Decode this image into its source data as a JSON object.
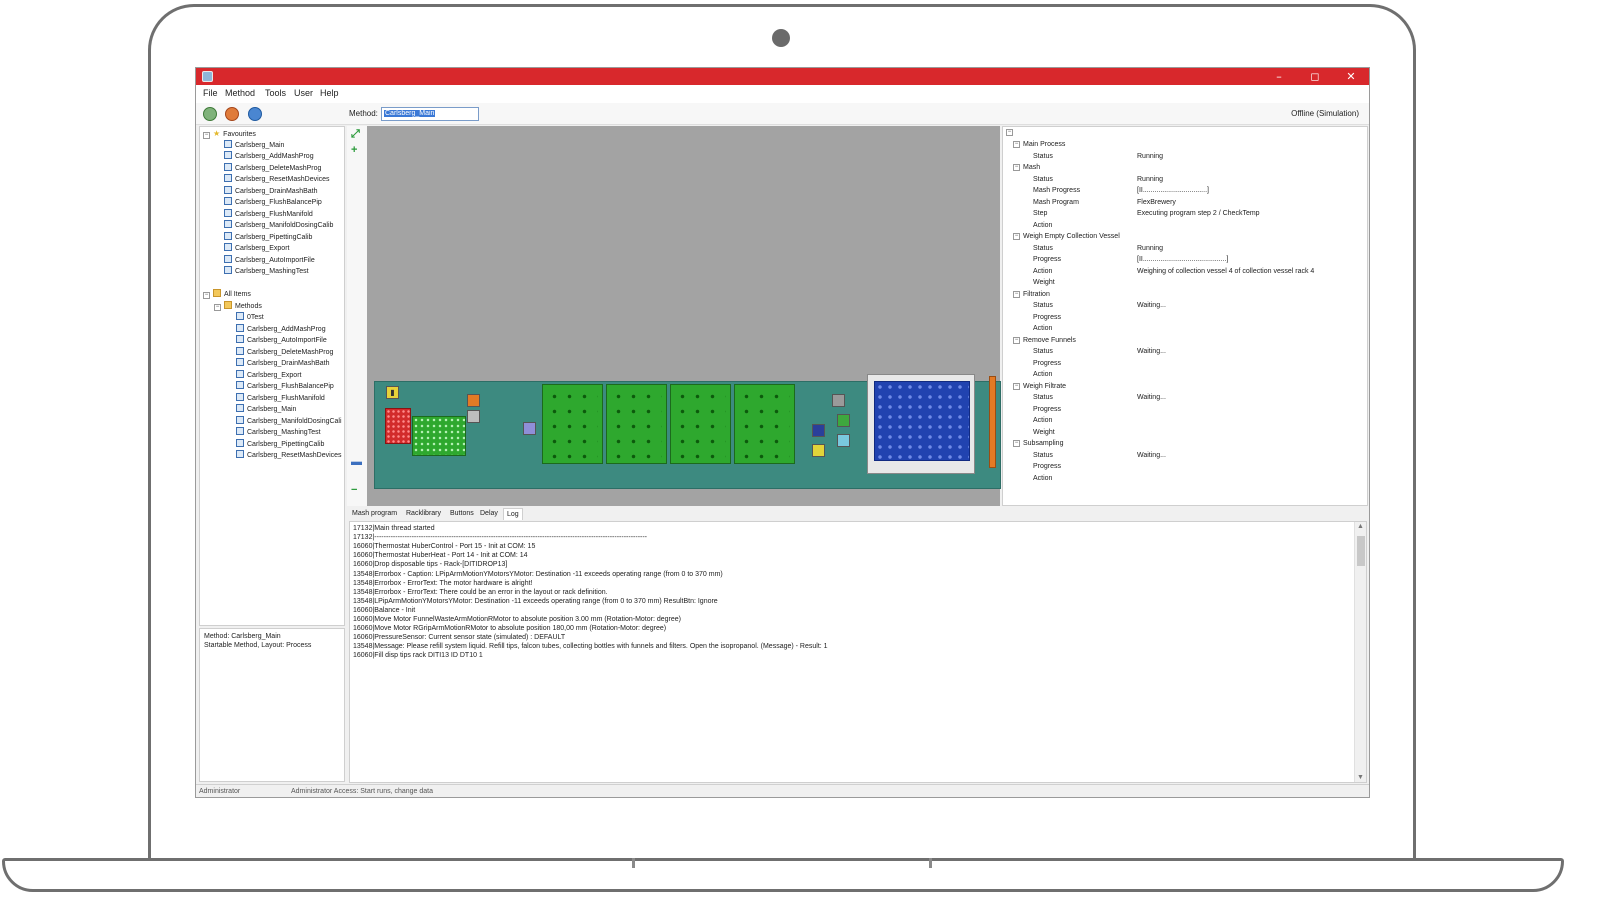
{
  "window": {
    "controls": {
      "minimize": "–",
      "maximize": "◻",
      "close": "✕"
    }
  },
  "menu": [
    "File",
    "Method",
    "Tools",
    "User",
    "Help"
  ],
  "toolbar": {
    "method_label": "Method:",
    "method_value": "Carlsberg_Main",
    "connection_status": "Offline (Simulation)"
  },
  "favourites": {
    "label": "Favourites",
    "items": [
      "Carlsberg_Main",
      "Carlsberg_AddMashProg",
      "Carlsberg_DeleteMashProg",
      "Carlsberg_ResetMashDevices",
      "Carlsberg_DrainMashBath",
      "Carlsberg_FlushBalancePip",
      "Carlsberg_FlushManifold",
      "Carlsberg_ManifoldDosingCalib",
      "Carlsberg_PipettingCalib",
      "Carlsberg_Export",
      "Carlsberg_AutoImportFile",
      "Carlsberg_MashingTest"
    ]
  },
  "all_items": {
    "label": "All Items",
    "methods_label": "Methods",
    "items": [
      "0Test",
      "Carlsberg_AddMashProg",
      "Carlsberg_AutoImportFile",
      "Carlsberg_DeleteMashProg",
      "Carlsberg_DrainMashBath",
      "Carlsberg_Export",
      "Carlsberg_FlushBalancePip",
      "Carlsberg_FlushManifold",
      "Carlsberg_Main",
      "Carlsberg_ManifoldDosingCali",
      "Carlsberg_MashingTest",
      "Carlsberg_PipettingCalib",
      "Carlsberg_ResetMashDevices"
    ]
  },
  "info": {
    "line1": "Method: Carlsberg_Main",
    "line2": "Startable Method, Layout: Process"
  },
  "status_tree": [
    {
      "level": 0,
      "key": "Main Process",
      "value": ""
    },
    {
      "level": 1,
      "key": "Status",
      "value": "Running"
    },
    {
      "level": 0,
      "key": "Mash",
      "value": ""
    },
    {
      "level": 1,
      "key": "Status",
      "value": "Running"
    },
    {
      "level": 1,
      "key": "Mash Progress",
      "value": "[II.................................]"
    },
    {
      "level": 1,
      "key": "Mash Program",
      "value": "FlexBrewery"
    },
    {
      "level": 1,
      "key": "Step",
      "value": "Executing program step 2 / CheckTemp"
    },
    {
      "level": 1,
      "key": "Action",
      "value": ""
    },
    {
      "level": 0,
      "key": "Weigh Empty Collection Vessel",
      "value": ""
    },
    {
      "level": 1,
      "key": "Status",
      "value": "Running"
    },
    {
      "level": 1,
      "key": "Progress",
      "value": "[II...........................................]"
    },
    {
      "level": 1,
      "key": "Action",
      "value": "Weighing of collection vessel 4 of collection vessel rack 4"
    },
    {
      "level": 1,
      "key": "Weight",
      "value": ""
    },
    {
      "level": 0,
      "key": "Filtration",
      "value": ""
    },
    {
      "level": 1,
      "key": "Status",
      "value": "Waiting..."
    },
    {
      "level": 1,
      "key": "Progress",
      "value": ""
    },
    {
      "level": 1,
      "key": "Action",
      "value": ""
    },
    {
      "level": 0,
      "key": "Remove Funnels",
      "value": ""
    },
    {
      "level": 1,
      "key": "Status",
      "value": "Waiting..."
    },
    {
      "level": 1,
      "key": "Progress",
      "value": ""
    },
    {
      "level": 1,
      "key": "Action",
      "value": ""
    },
    {
      "level": 0,
      "key": "Weigh Filtrate",
      "value": ""
    },
    {
      "level": 1,
      "key": "Status",
      "value": "Waiting..."
    },
    {
      "level": 1,
      "key": "Progress",
      "value": ""
    },
    {
      "level": 1,
      "key": "Action",
      "value": ""
    },
    {
      "level": 1,
      "key": "Weight",
      "value": ""
    },
    {
      "level": 0,
      "key": "Subsampling",
      "value": ""
    },
    {
      "level": 1,
      "key": "Status",
      "value": "Waiting..."
    },
    {
      "level": 1,
      "key": "Progress",
      "value": ""
    },
    {
      "level": 1,
      "key": "Action",
      "value": ""
    }
  ],
  "tabs": [
    "Mash program",
    "Racklibrary",
    "Buttons",
    "Delay",
    "Log"
  ],
  "active_tab": "Log",
  "log": [
    "17132|Main thread started",
    "17132|---------------------------------------------------------------------------------------------------------------------",
    "16060|Thermostat HuberControl - Port 15 - Init at COM: 15",
    "16060|Thermostat HuberHeat - Port 14 - Init at COM: 14",
    "16060|Drop disposable tips - Rack-[DITIDROP13]",
    "13548|Errorbox - Caption: LPipArmMotionYMotorsYMotor: Destination -11 exceeds operating range (from 0 to 370 mm)",
    "13548|Errorbox - ErrorText: The motor hardware is alright!",
    "13548|Errorbox - ErrorText: There could be an error in the layout or rack definition.",
    "13548|LPipArmMotionYMotorsYMotor: Destination -11 exceeds operating range (from 0 to 370 mm) ResultBtn: Ignore",
    "16060|Balance - Init",
    "16060|Move Motor FunnelWasteArmMotionRMotor to absolute position 3.00 mm (Rotation-Motor: degree)",
    "16060|Move Motor RGripArmMotionRMotor to absolute position 180,00 mm (Rotation-Motor: degree)",
    "16060|PressureSensor: Current sensor state (simulated) : DEFAULT",
    "13548|Message: Please refill system liquid. Refill tips, falcon tubes, collecting bottles with funnels and filters. Open the isopropanol.  (Message) - Result: 1",
    "16060|Fill disp tips rack DITI13 ID DT10  1"
  ],
  "statusbar": {
    "user": "Administrator",
    "access": "Administrator Access: Start runs, change data"
  },
  "colors": {
    "titlebar": "#d8282c",
    "deck": "#3d8a80",
    "canvas": "#a3a3a3"
  }
}
